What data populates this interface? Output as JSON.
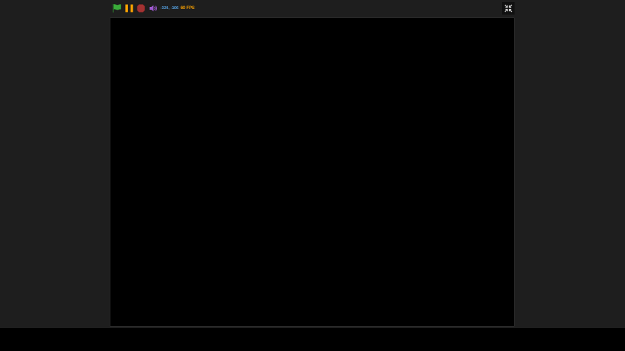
{
  "window": {
    "background": "#1e1e1e"
  },
  "controls": {
    "green_flag": {
      "icon": "green-flag-icon",
      "color": "#33aa33"
    },
    "pause": {
      "icon": "pause-icon",
      "color": "#ffa500"
    },
    "stop": {
      "icon": "stop-icon",
      "color": "#a33232"
    },
    "volume": {
      "icon": "speaker-icon",
      "color": "#a05ad2"
    },
    "mouse_coordinates": "-320, -106",
    "fps": "60 FPS",
    "colors": {
      "coordinates": "#58a6e8",
      "fps": "#ffa500"
    }
  },
  "fullscreen_toggle": {
    "icon": "exit-fullscreen-icon"
  },
  "stage": {
    "background": "#000000"
  }
}
